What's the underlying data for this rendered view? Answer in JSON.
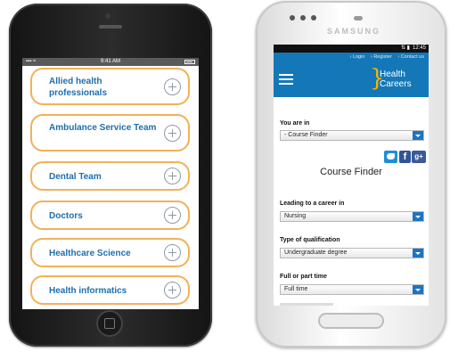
{
  "iphone": {
    "status": {
      "time": "9:41 AM"
    },
    "items": [
      {
        "label": "Allied health professionals"
      },
      {
        "label": "Ambulance Service Team"
      },
      {
        "label": "Dental Team"
      },
      {
        "label": "Doctors"
      },
      {
        "label": "Healthcare Science"
      },
      {
        "label": "Health informatics"
      }
    ]
  },
  "samsung": {
    "brand": "SAMSUNG",
    "status": {
      "time": "12:45"
    },
    "header": {
      "links": [
        "Login",
        "Register",
        "Contact us"
      ],
      "logo_line1": "Health",
      "logo_line2": "Careers"
    },
    "you_are_in": {
      "label": "You are in",
      "value": "- Course Finder"
    },
    "social": {
      "facebook": "f",
      "gplus": "g+"
    },
    "page_title": "Course Finder",
    "career": {
      "label": "Leading to a career in",
      "value": "Nursing"
    },
    "qualification": {
      "label": "Type of qualification",
      "value": "Undergraduate degree"
    },
    "study_mode": {
      "label": "Full or part time",
      "value": "Full time"
    }
  },
  "colors": {
    "header_blue": "#1478b8",
    "pill_border": "#f2b15a",
    "link_blue": "#1d6fae",
    "logo_yellow": "#f5b400"
  }
}
